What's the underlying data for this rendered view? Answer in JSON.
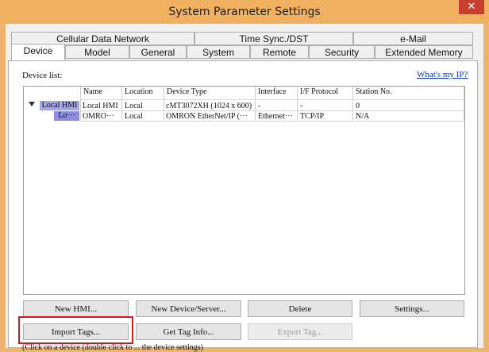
{
  "window": {
    "title": "System Parameter Settings",
    "close_glyph": "✕"
  },
  "tabs": {
    "row1": [
      "Cellular Data Network",
      "Time Sync./DST",
      "e-Mail"
    ],
    "row2": [
      "Device",
      "Model",
      "General",
      "System",
      "Remote",
      "Security",
      "Extended Memory"
    ],
    "active": "Device"
  },
  "device_panel": {
    "label": "Device list:",
    "help_link": "What's my IP?",
    "columns": [
      "Name",
      "Location",
      "Device Type",
      "Interface",
      "I/F Protocol",
      "Station No."
    ],
    "tree": {
      "root_node": "Local HMI",
      "child_node": "Lo···"
    },
    "rows": [
      {
        "name": "Local HMI",
        "location": "Local",
        "device_type": "cMT3072XH (1024 x 600)",
        "interface": "-",
        "protocol": "-",
        "station": "0"
      },
      {
        "name": "OMRO···",
        "location": "Local",
        "device_type": "OMRON EtherNet/IP (···",
        "interface": "Ethernet···",
        "protocol": "TCP/IP",
        "station": "N/A"
      }
    ]
  },
  "buttons": {
    "new_hmi": "New HMI...",
    "new_device": "New Device/Server...",
    "delete": "Delete",
    "settings": "Settings...",
    "import_tags": "Import Tags...",
    "get_tag_info": "Get Tag Info...",
    "export_tag": "Export Tag..."
  },
  "footnote": "(Click on a device (double click to ... the device settings)"
}
